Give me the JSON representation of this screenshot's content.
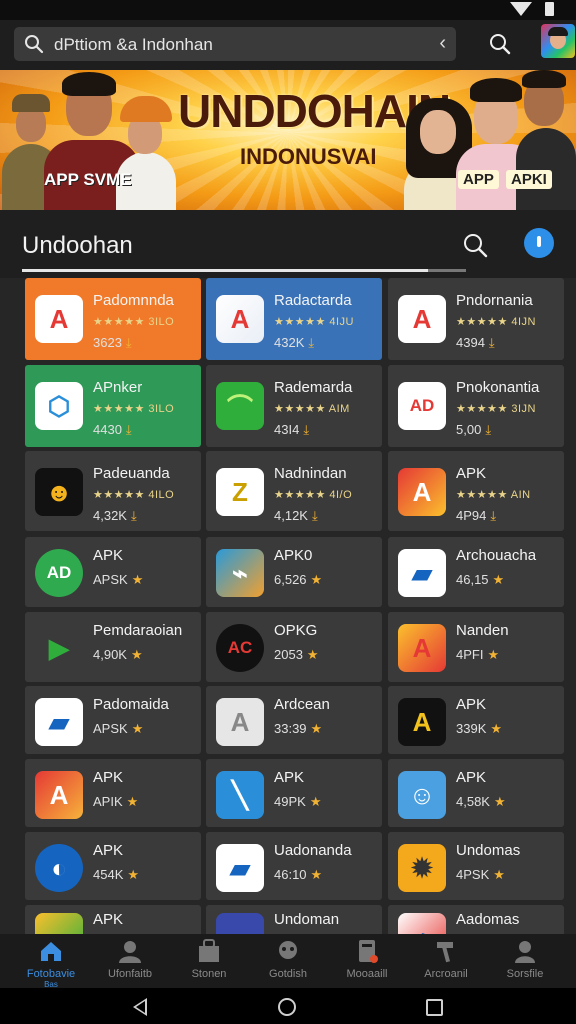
{
  "search": {
    "value": "dPttiom &a Indonhan"
  },
  "banner": {
    "title": "UNDDOHAIN",
    "subtitle": "INDONUSVAI",
    "badge_left": "APP SVME",
    "badge_right_1": "APP",
    "badge_right_2": "APKI"
  },
  "section": {
    "title": "Undoohan"
  },
  "apps": [
    {
      "name": "Padomnnda",
      "rating": "★★★★★ 3ILO",
      "size": "3623",
      "sizeIcon": "dl",
      "bg": "#f07a2a"
    },
    {
      "name": "Radactarda",
      "rating": "★★★★★ 4IJU",
      "size": "432K",
      "sizeIcon": "dl",
      "bg": "#3a72b8"
    },
    {
      "name": "Pndornania",
      "rating": "★★★★★ 4IJN",
      "size": "4394",
      "sizeIcon": "dl",
      "bg": "#3a3a3a"
    },
    {
      "name": "APnker",
      "rating": "★★★★★ 3ILO",
      "size": "4430",
      "sizeIcon": "dl",
      "bg": "#2f9a58"
    },
    {
      "name": "Rademarda",
      "rating": "★★★★★ AIM",
      "size": "43I4",
      "sizeIcon": "dl",
      "bg": "#3a3a3a"
    },
    {
      "name": "Pnokonantia",
      "rating": "★★★★★ 3IJN",
      "size": "5,00",
      "sizeIcon": "dl",
      "bg": "#3a3a3a"
    },
    {
      "name": "Padeuanda",
      "rating": "★★★★★ 4ILO",
      "size": "4,32K",
      "sizeIcon": "dl",
      "bg": "#3a3a3a"
    },
    {
      "name": "Nadnindan",
      "rating": "★★★★★ 4I/O",
      "size": "4,12K",
      "sizeIcon": "dl",
      "bg": "#3a3a3a"
    },
    {
      "name": "APK",
      "rating": "★★★★★ AIN",
      "size": "4P94",
      "sizeIcon": "dl",
      "bg": "#3a3a3a"
    },
    {
      "name": "APK",
      "rating": "",
      "size": "APSK",
      "sizeIcon": "star",
      "bg": "#3a3a3a"
    },
    {
      "name": "APK0",
      "rating": "",
      "size": "6,526",
      "sizeIcon": "star",
      "bg": "#3a3a3a"
    },
    {
      "name": "Archouacha",
      "rating": "",
      "size": "46,15",
      "sizeIcon": "star",
      "bg": "#3a3a3a"
    },
    {
      "name": "Pemdaraoian",
      "rating": "",
      "size": "4,90K",
      "sizeIcon": "star",
      "bg": "#3a3a3a"
    },
    {
      "name": "OPKG",
      "rating": "",
      "size": "2053",
      "sizeIcon": "star",
      "bg": "#3a3a3a"
    },
    {
      "name": "Nanden",
      "rating": "",
      "size": "4PFI",
      "sizeIcon": "star",
      "bg": "#3a3a3a"
    },
    {
      "name": "Padomaida",
      "rating": "",
      "size": "APSK",
      "sizeIcon": "star",
      "bg": "#3a3a3a"
    },
    {
      "name": "Ardcean",
      "rating": "",
      "size": "33:39",
      "sizeIcon": "star",
      "bg": "#3a3a3a"
    },
    {
      "name": "APK",
      "rating": "",
      "size": "339K",
      "sizeIcon": "star",
      "bg": "#3a3a3a"
    },
    {
      "name": "APK",
      "rating": "",
      "size": "APIK",
      "sizeIcon": "star",
      "bg": "#3a3a3a"
    },
    {
      "name": "APK",
      "rating": "",
      "size": "49PK",
      "sizeIcon": "star",
      "bg": "#3a3a3a"
    },
    {
      "name": "APK",
      "rating": "",
      "size": "4,58K",
      "sizeIcon": "star",
      "bg": "#3a3a3a"
    },
    {
      "name": "APK",
      "rating": "",
      "size": "454K",
      "sizeIcon": "star",
      "bg": "#3a3a3a"
    },
    {
      "name": "Uadonanda",
      "rating": "",
      "size": "46:10",
      "sizeIcon": "star",
      "bg": "#3a3a3a"
    },
    {
      "name": "Undomas",
      "rating": "",
      "size": "4PSK",
      "sizeIcon": "star",
      "bg": "#3a3a3a"
    },
    {
      "name": "APK",
      "rating": "",
      "size": "",
      "sizeIcon": "",
      "bg": "#3a3a3a"
    },
    {
      "name": "Undoman",
      "rating": "",
      "size": "",
      "sizeIcon": "",
      "bg": "#3a3a3a"
    },
    {
      "name": "Aadomas",
      "rating": "",
      "size": "",
      "sizeIcon": "",
      "bg": "#3a3a3a"
    }
  ],
  "nav": [
    {
      "label": "Fotobavie",
      "label2": "Bas",
      "icon": "home-icon"
    },
    {
      "label": "Ufonfaitb",
      "icon": "person-icon"
    },
    {
      "label": "Stonen",
      "icon": "store-icon"
    },
    {
      "label": "Gotdish",
      "icon": "game-icon"
    },
    {
      "label": "Mooaaill",
      "icon": "book-icon"
    },
    {
      "label": "Arcroanil",
      "icon": "hammer-icon"
    },
    {
      "label": "Sorsfile",
      "icon": "profile-icon"
    }
  ]
}
